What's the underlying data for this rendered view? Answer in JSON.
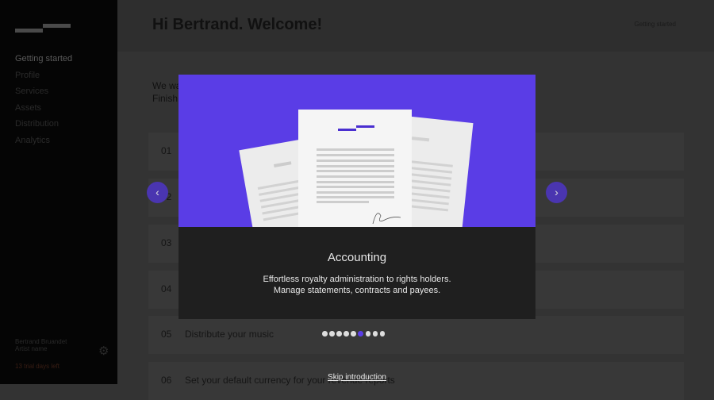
{
  "sidebar": {
    "nav": [
      "Getting started",
      "Profile",
      "Services",
      "Assets",
      "Distribution",
      "Analytics"
    ],
    "user_name": "Bertrand Bruandet",
    "user_role": "Artist name",
    "trial": "13 trial days left"
  },
  "header": {
    "title": "Hi Bertrand. Welcome!",
    "link": "Getting started"
  },
  "intro": {
    "line1": "We wa",
    "line2": "Finish"
  },
  "steps": [
    {
      "n": "01",
      "t": ""
    },
    {
      "n": "02",
      "t": ""
    },
    {
      "n": "03",
      "t": ""
    },
    {
      "n": "04",
      "t": ""
    },
    {
      "n": "05",
      "t": "Distribute your music"
    },
    {
      "n": "06",
      "t": "Set your default currency for your revenue reports"
    }
  ],
  "modal": {
    "title": "Accounting",
    "desc1": "Effortless royalty administration to rights holders.",
    "desc2": "Manage statements, contracts and payees.",
    "prev": "‹",
    "next": "›",
    "skip": "Skip introduction",
    "slides": 9,
    "active_slide": 6
  },
  "colors": {
    "accent": "#5a3de6"
  }
}
